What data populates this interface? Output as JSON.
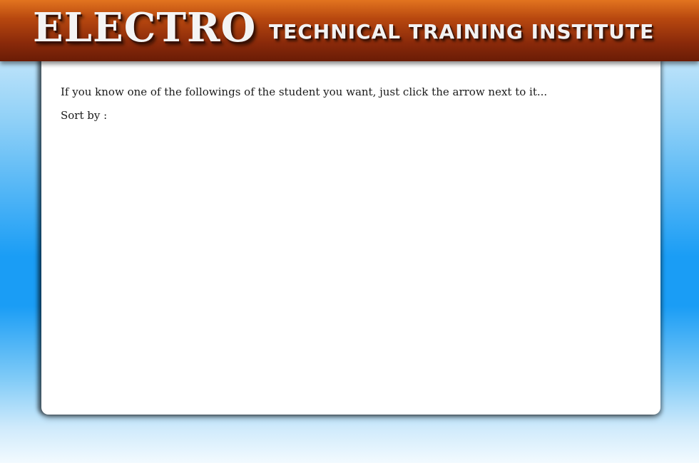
{
  "header": {
    "logo_text": "ELECTRO",
    "subtitle": "TECHNICAL TRAINING INSTITUTE"
  },
  "main": {
    "instruction": "If you know one of the followings of the student you want, just click the arrow next to it...",
    "sort_label": "Sort by :"
  },
  "colors": {
    "header_top": "#e2741f",
    "header_bottom": "#6a1c06",
    "background_blue": "#1a9df5",
    "panel": "#ffffff"
  }
}
